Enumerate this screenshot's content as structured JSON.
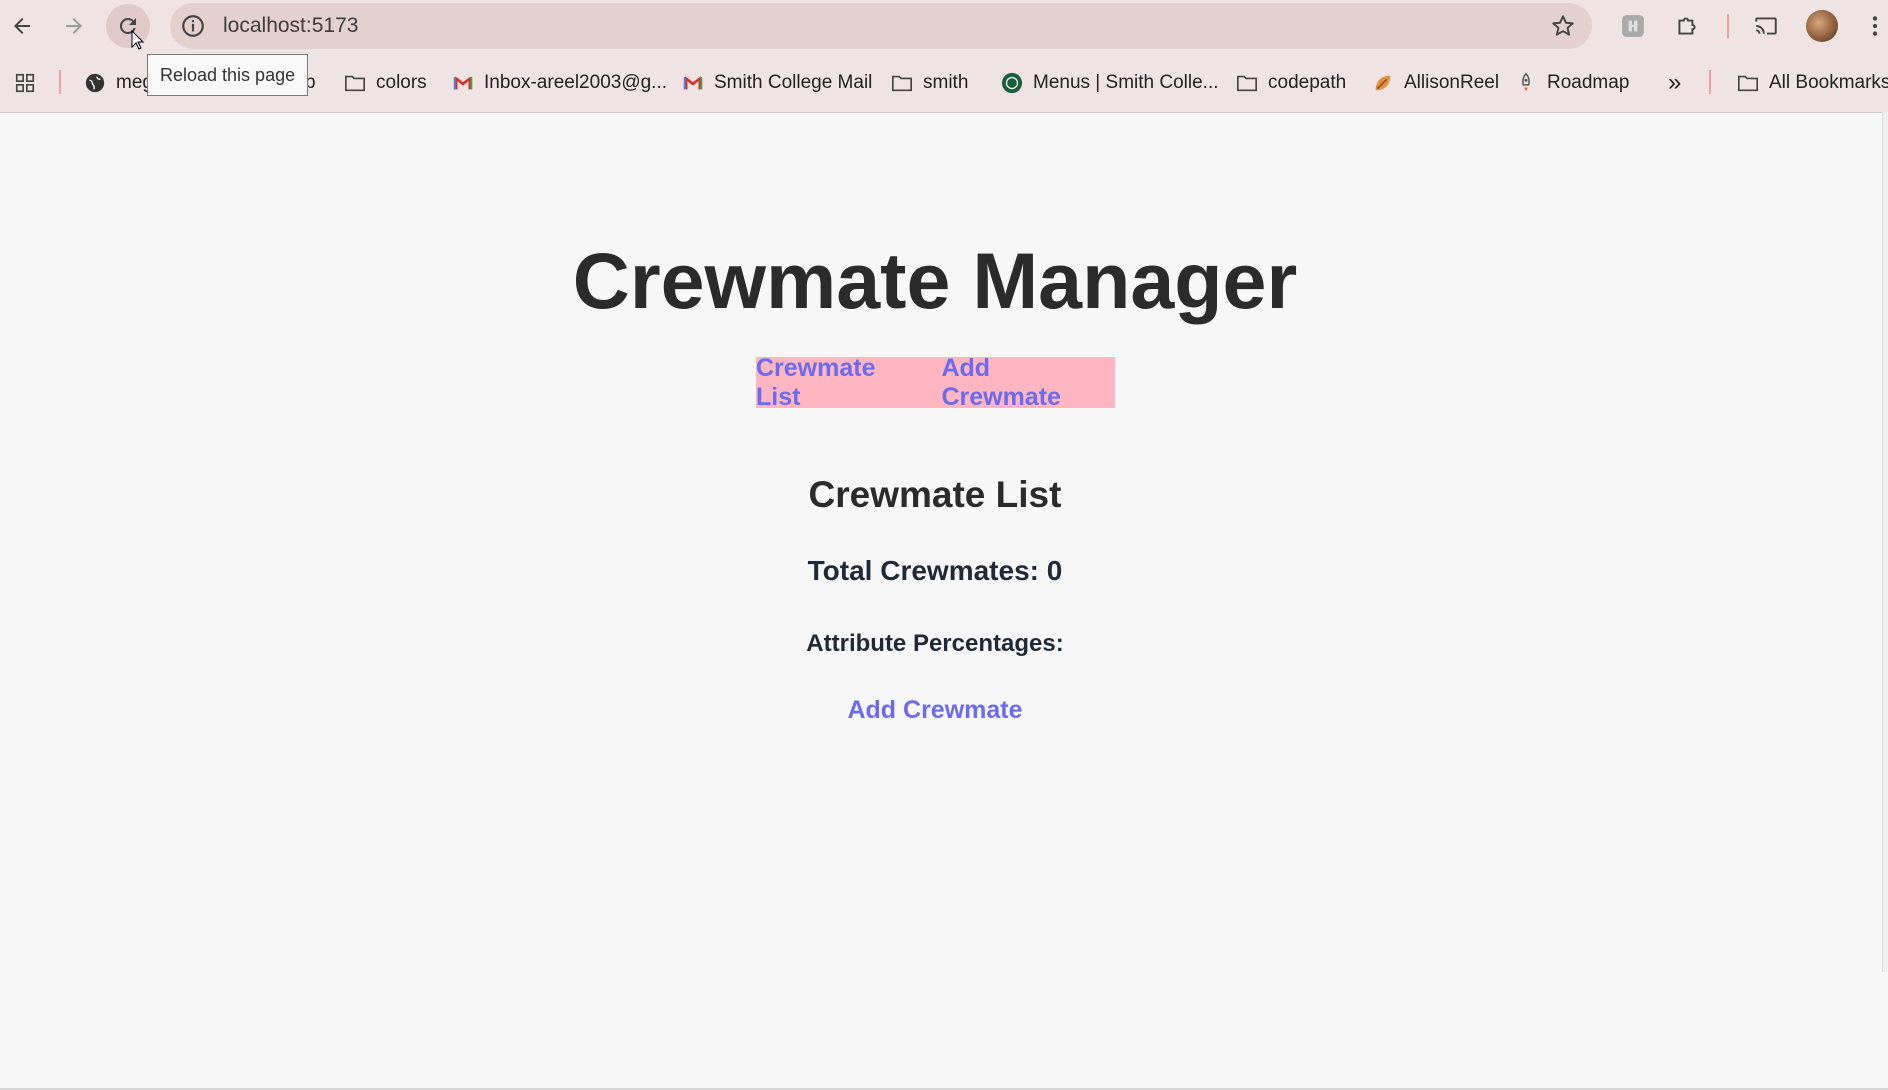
{
  "browser": {
    "url": "localhost:5173",
    "tooltip": "Reload this page",
    "icons": [
      "back-arrow-icon",
      "forward-arrow-icon",
      "reload-icon",
      "info-icon",
      "star-icon",
      "extension-icon",
      "puzzle-icon",
      "cast-icon",
      "more-vert-icon",
      "apps-grid-icon"
    ],
    "bookmarks": [
      {
        "label": "meg",
        "icon": "globe-icon"
      },
      {
        "label": "b",
        "icon": "none"
      },
      {
        "label": "colors",
        "icon": "folder-icon"
      },
      {
        "label": "Inbox-areel2003@g...",
        "icon": "gmail-icon"
      },
      {
        "label": "Smith College Mail",
        "icon": "gmail-icon"
      },
      {
        "label": "smith",
        "icon": "folder-icon"
      },
      {
        "label": "Menus | Smith Colle...",
        "icon": "smith-seal-icon"
      },
      {
        "label": "codepath",
        "icon": "folder-icon"
      },
      {
        "label": "AllisonReel",
        "icon": "leaf-icon"
      },
      {
        "label": "Roadmap",
        "icon": "rocket-icon"
      }
    ],
    "overflow_label": "»",
    "all_bookmarks": "All Bookmarks"
  },
  "page": {
    "title": "Crewmate Manager",
    "nav": {
      "crewmate_list": "Crewmate List",
      "add_crewmate": "Add Crewmate"
    },
    "section_title": "Crewmate List",
    "total": "Total Crewmates: 0",
    "attribute_heading": "Attribute Percentages:",
    "add_link": "Add Crewmate"
  },
  "colors": {
    "nav_background": "#ffb6c1",
    "link": "#6b6bef",
    "page_background": "#f7f7f7",
    "browser_chrome": "#efe3e3"
  }
}
